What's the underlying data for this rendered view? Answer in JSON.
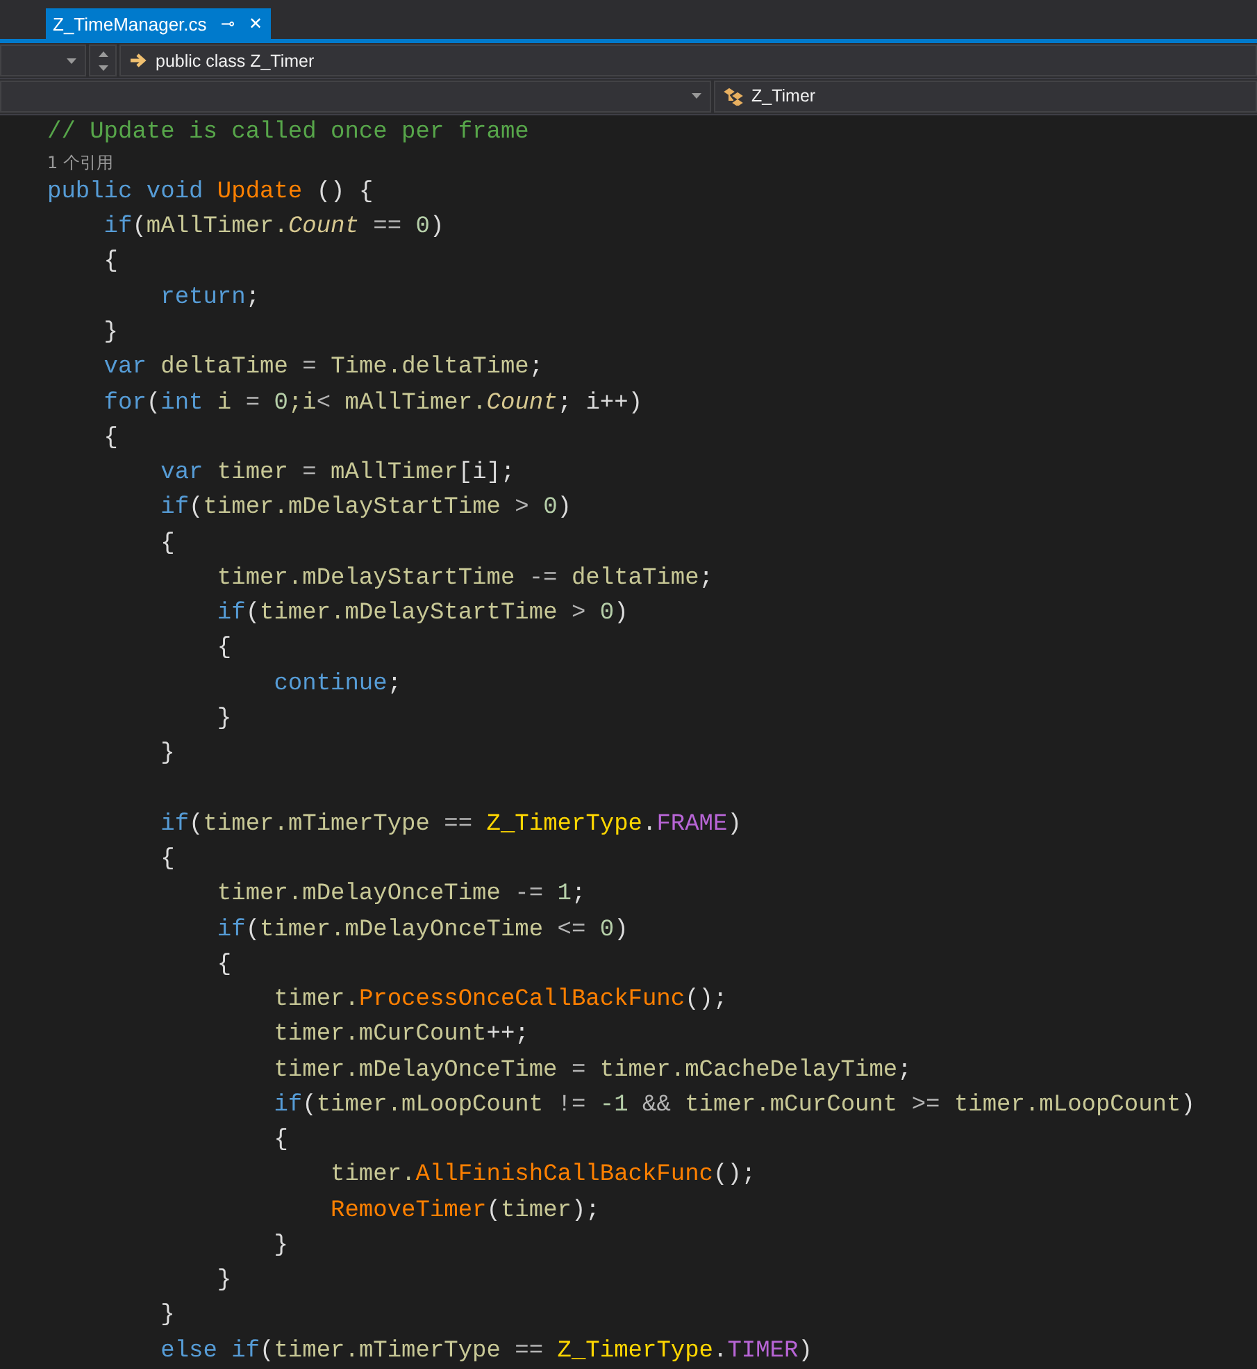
{
  "tab": {
    "title": "Z_TimeManager.cs",
    "pin": "⊸",
    "close": "✕",
    "selected": true
  },
  "nav_bar": {
    "member": "public class Z_Timer"
  },
  "nav_bar_2": {
    "type": "Z_Timer"
  },
  "editor": {
    "lines": [
      {
        "tokens": [
          {
            "text": "// Update is called once per frame",
            "kind": "comment"
          }
        ]
      },
      {
        "tokens": [
          {
            "text": "1 个引用",
            "kind": "codelens"
          }
        ]
      },
      {
        "tokens": [
          {
            "text": "public void ",
            "kind": "kw"
          },
          {
            "text": "Update",
            "kind": "method"
          },
          {
            "text": " () {",
            "kind": "punct"
          }
        ]
      },
      {
        "tokens": [
          {
            "text": "    if",
            "kind": "kw"
          },
          {
            "text": "(",
            "kind": "punct"
          },
          {
            "text": "mAllTimer.",
            "kind": "id"
          },
          {
            "text": "Count",
            "kind": "prop"
          },
          {
            "text": " == ",
            "kind": "op"
          },
          {
            "text": "0",
            "kind": "num"
          },
          {
            "text": ")",
            "kind": "punct"
          }
        ]
      },
      {
        "tokens": [
          {
            "text": "    {",
            "kind": "punct"
          }
        ]
      },
      {
        "tokens": [
          {
            "text": "        return",
            "kind": "kw"
          },
          {
            "text": ";",
            "kind": "punct"
          }
        ]
      },
      {
        "tokens": [
          {
            "text": "    }",
            "kind": "punct"
          }
        ]
      },
      {
        "tokens": [
          {
            "text": "    var ",
            "kind": "kw"
          },
          {
            "text": "deltaTime",
            "kind": "id"
          },
          {
            "text": " = ",
            "kind": "op"
          },
          {
            "text": "Time.deltaTime",
            "kind": "id"
          },
          {
            "text": ";",
            "kind": "punct"
          }
        ]
      },
      {
        "tokens": [
          {
            "text": "    for",
            "kind": "kw"
          },
          {
            "text": "(",
            "kind": "punct"
          },
          {
            "text": "int",
            "kind": "kw"
          },
          {
            "text": " i ",
            "kind": "id"
          },
          {
            "text": "= ",
            "kind": "op"
          },
          {
            "text": "0",
            "kind": "num"
          },
          {
            "text": ";i",
            "kind": "id"
          },
          {
            "text": "< ",
            "kind": "op"
          },
          {
            "text": "mAllTimer.",
            "kind": "id"
          },
          {
            "text": "Count",
            "kind": "prop"
          },
          {
            "text": "; i++)",
            "kind": "punct"
          }
        ]
      },
      {
        "tokens": [
          {
            "text": "    {",
            "kind": "punct"
          }
        ]
      },
      {
        "tokens": [
          {
            "text": "        var ",
            "kind": "kw"
          },
          {
            "text": "timer",
            "kind": "id"
          },
          {
            "text": " = ",
            "kind": "op"
          },
          {
            "text": "mAllTimer",
            "kind": "id"
          },
          {
            "text": "[i];",
            "kind": "punct"
          }
        ]
      },
      {
        "tokens": [
          {
            "text": "        if",
            "kind": "kw"
          },
          {
            "text": "(",
            "kind": "punct"
          },
          {
            "text": "timer.mDelayStartTime",
            "kind": "id"
          },
          {
            "text": " > ",
            "kind": "op"
          },
          {
            "text": "0",
            "kind": "num"
          },
          {
            "text": ")",
            "kind": "punct"
          }
        ]
      },
      {
        "tokens": [
          {
            "text": "        {",
            "kind": "punct"
          }
        ]
      },
      {
        "tokens": [
          {
            "text": "            timer.mDelayStartTime",
            "kind": "id"
          },
          {
            "text": " -= ",
            "kind": "op"
          },
          {
            "text": "deltaTime",
            "kind": "id"
          },
          {
            "text": ";",
            "kind": "punct"
          }
        ]
      },
      {
        "tokens": [
          {
            "text": "            if",
            "kind": "kw"
          },
          {
            "text": "(",
            "kind": "punct"
          },
          {
            "text": "timer.mDelayStartTime",
            "kind": "id"
          },
          {
            "text": " > ",
            "kind": "op"
          },
          {
            "text": "0",
            "kind": "num"
          },
          {
            "text": ")",
            "kind": "punct"
          }
        ]
      },
      {
        "tokens": [
          {
            "text": "            {",
            "kind": "punct"
          }
        ]
      },
      {
        "tokens": [
          {
            "text": "                continue",
            "kind": "kw"
          },
          {
            "text": ";",
            "kind": "punct"
          }
        ]
      },
      {
        "tokens": [
          {
            "text": "            }",
            "kind": "punct"
          }
        ]
      },
      {
        "tokens": [
          {
            "text": "        }",
            "kind": "punct"
          }
        ]
      },
      {
        "kind": "blank"
      },
      {
        "tokens": [
          {
            "text": "        if",
            "kind": "kw"
          },
          {
            "text": "(",
            "kind": "punct"
          },
          {
            "text": "timer.mTimerType",
            "kind": "id"
          },
          {
            "text": " == ",
            "kind": "op"
          },
          {
            "text": "Z_TimerType",
            "kind": "type"
          },
          {
            "text": ".",
            "kind": "punct"
          },
          {
            "text": "FRAME",
            "kind": "enum"
          },
          {
            "text": ")",
            "kind": "punct"
          }
        ]
      },
      {
        "tokens": [
          {
            "text": "        {",
            "kind": "punct"
          }
        ]
      },
      {
        "tokens": [
          {
            "text": "            timer.mDelayOnceTime",
            "kind": "id"
          },
          {
            "text": " -= ",
            "kind": "op"
          },
          {
            "text": "1",
            "kind": "num"
          },
          {
            "text": ";",
            "kind": "punct"
          }
        ]
      },
      {
        "tokens": [
          {
            "text": "            if",
            "kind": "kw"
          },
          {
            "text": "(",
            "kind": "punct"
          },
          {
            "text": "timer.mDelayOnceTime",
            "kind": "id"
          },
          {
            "text": " <= ",
            "kind": "op"
          },
          {
            "text": "0",
            "kind": "num"
          },
          {
            "text": ")",
            "kind": "punct"
          }
        ]
      },
      {
        "tokens": [
          {
            "text": "            {",
            "kind": "punct"
          }
        ]
      },
      {
        "tokens": [
          {
            "text": "                timer.",
            "kind": "id"
          },
          {
            "text": "ProcessOnceCallBackFunc",
            "kind": "method"
          },
          {
            "text": "();",
            "kind": "punct"
          }
        ]
      },
      {
        "tokens": [
          {
            "text": "                timer.mCurCount",
            "kind": "id"
          },
          {
            "text": "++;",
            "kind": "punct"
          }
        ]
      },
      {
        "tokens": [
          {
            "text": "                timer.mDelayOnceTime",
            "kind": "id"
          },
          {
            "text": " = ",
            "kind": "op"
          },
          {
            "text": "timer.mCacheDelayTime",
            "kind": "id"
          },
          {
            "text": ";",
            "kind": "punct"
          }
        ]
      },
      {
        "tokens": [
          {
            "text": "                if",
            "kind": "kw"
          },
          {
            "text": "(",
            "kind": "punct"
          },
          {
            "text": "timer.mLoopCount",
            "kind": "id"
          },
          {
            "text": " != ",
            "kind": "op"
          },
          {
            "text": "-1",
            "kind": "num"
          },
          {
            "text": " && ",
            "kind": "op"
          },
          {
            "text": "timer.mCurCount",
            "kind": "id"
          },
          {
            "text": " >= ",
            "kind": "op"
          },
          {
            "text": "timer.mLoopCount",
            "kind": "id"
          },
          {
            "text": ")",
            "kind": "punct"
          }
        ]
      },
      {
        "tokens": [
          {
            "text": "                {",
            "kind": "punct"
          }
        ]
      },
      {
        "tokens": [
          {
            "text": "                    timer.",
            "kind": "id"
          },
          {
            "text": "AllFinishCallBackFunc",
            "kind": "method"
          },
          {
            "text": "();",
            "kind": "punct"
          }
        ]
      },
      {
        "tokens": [
          {
            "text": "                    RemoveTimer",
            "kind": "method"
          },
          {
            "text": "(",
            "kind": "punct"
          },
          {
            "text": "timer",
            "kind": "id"
          },
          {
            "text": ");",
            "kind": "punct"
          }
        ]
      },
      {
        "tokens": [
          {
            "text": "                }",
            "kind": "punct"
          }
        ]
      },
      {
        "tokens": [
          {
            "text": "            }",
            "kind": "punct"
          }
        ]
      },
      {
        "tokens": [
          {
            "text": "        }",
            "kind": "punct"
          }
        ]
      },
      {
        "tokens": [
          {
            "text": "        else if",
            "kind": "kw"
          },
          {
            "text": "(",
            "kind": "punct"
          },
          {
            "text": "timer.mTimerType",
            "kind": "id"
          },
          {
            "text": " == ",
            "kind": "op"
          },
          {
            "text": "Z_TimerType",
            "kind": "type"
          },
          {
            "text": ".",
            "kind": "punct"
          },
          {
            "text": "TIMER",
            "kind": "enum"
          },
          {
            "text": ")",
            "kind": "punct"
          }
        ]
      }
    ]
  }
}
